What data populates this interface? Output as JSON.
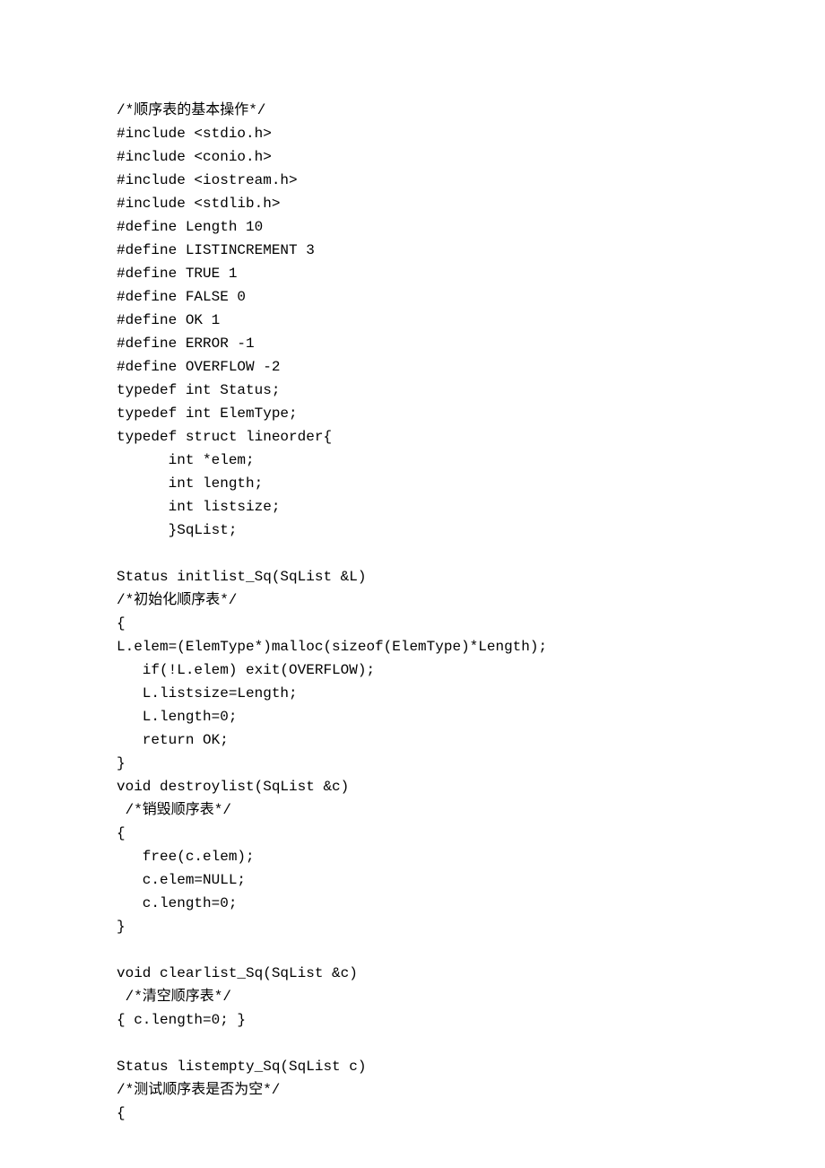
{
  "code_lines": [
    "/*顺序表的基本操作*/",
    "#include <stdio.h>",
    "#include <conio.h>",
    "#include <iostream.h>",
    "#include <stdlib.h>",
    "#define Length 10",
    "#define LISTINCREMENT 3",
    "#define TRUE 1",
    "#define FALSE 0",
    "#define OK 1",
    "#define ERROR -1",
    "#define OVERFLOW -2",
    "typedef int Status;",
    "typedef int ElemType;",
    "typedef struct lineorder{",
    "      int *elem;",
    "      int length;",
    "      int listsize;",
    "      }SqList;",
    "",
    "Status initlist_Sq(SqList &L)",
    "/*初始化顺序表*/",
    "{",
    "L.elem=(ElemType*)malloc(sizeof(ElemType)*Length);",
    "   if(!L.elem) exit(OVERFLOW);",
    "   L.listsize=Length;",
    "   L.length=0;",
    "   return OK;",
    "}",
    "void destroylist(SqList &c)",
    " /*销毁顺序表*/",
    "{",
    "   free(c.elem);",
    "   c.elem=NULL;",
    "   c.length=0;",
    "}",
    "",
    "void clearlist_Sq(SqList &c)",
    " /*清空顺序表*/",
    "{ c.length=0; }",
    "",
    "Status listempty_Sq(SqList c)",
    "/*测试顺序表是否为空*/",
    "{"
  ]
}
